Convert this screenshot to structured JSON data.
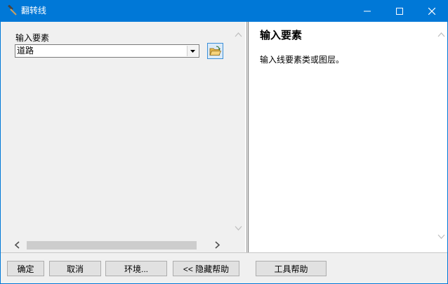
{
  "window": {
    "title": "翻转线"
  },
  "form": {
    "input_label": "输入要素",
    "input_value": "道路"
  },
  "help": {
    "title": "输入要素",
    "text": "输入线要素类或图层。"
  },
  "buttons": {
    "ok": "确定",
    "cancel": "取消",
    "environments": "环境...",
    "hide_help": "<< 隐藏帮助",
    "tool_help": "工具帮助"
  }
}
